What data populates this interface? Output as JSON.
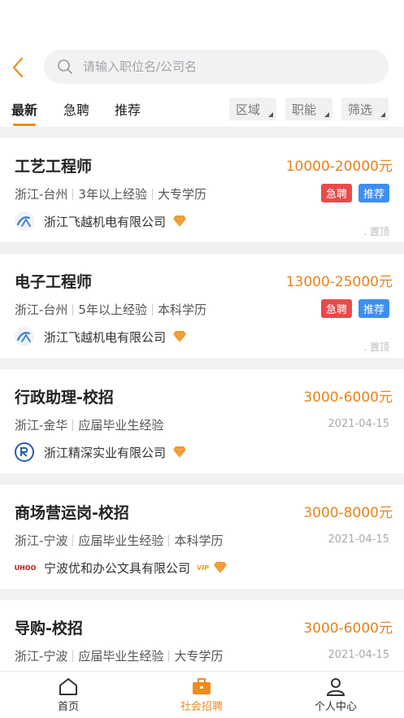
{
  "search": {
    "placeholder": "请输入职位名/公司名"
  },
  "tabs": [
    {
      "label": "最新",
      "active": true
    },
    {
      "label": "急聘",
      "active": false
    },
    {
      "label": "推荐",
      "active": false
    }
  ],
  "filters": [
    "区域",
    "职能",
    "筛选"
  ],
  "jobs": [
    {
      "title": "工艺工程师",
      "salary": "10000-20000元",
      "location": "浙江-台州",
      "experience": "3年以上经验",
      "education": "大专学历",
      "badges": [
        "急聘",
        "推荐"
      ],
      "company": "浙江飞越机电有限公司",
      "pin": "置顶"
    },
    {
      "title": "电子工程师",
      "salary": "13000-25000元",
      "location": "浙江-台州",
      "experience": "5年以上经验",
      "education": "本科学历",
      "badges": [
        "急聘",
        "推荐"
      ],
      "company": "浙江飞越机电有限公司",
      "pin": "置顶"
    },
    {
      "title": "行政助理-校招",
      "salary": "3000-6000元",
      "location": "浙江-金华",
      "experience": "应届毕业生经验",
      "education": "",
      "date": "2021-04-15",
      "company": "浙江精深实业有限公司"
    },
    {
      "title": "商场营运岗-校招",
      "salary": "3000-8000元",
      "location": "浙江-宁波",
      "experience": "应届毕业生经验",
      "education": "本科学历",
      "date": "2021-04-15",
      "company": "宁波优和办公文具有限公司",
      "logo_text": "UHOO",
      "vip_text": "VIP"
    },
    {
      "title": "导购-校招",
      "salary": "3000-6000元",
      "location": "浙江-宁波",
      "experience": "应届毕业生经验",
      "education": "大专学历",
      "date": "2021-04-15"
    }
  ],
  "tabbar": [
    {
      "label": "首页",
      "icon": "home-icon"
    },
    {
      "label": "社会招聘",
      "icon": "briefcase-icon",
      "active": true
    },
    {
      "label": "个人中心",
      "icon": "user-icon"
    }
  ],
  "colors": {
    "accent": "#f08a1b",
    "salary": "#e9821a",
    "urgent": "#e84a4a",
    "recommend": "#3d8ef0"
  }
}
